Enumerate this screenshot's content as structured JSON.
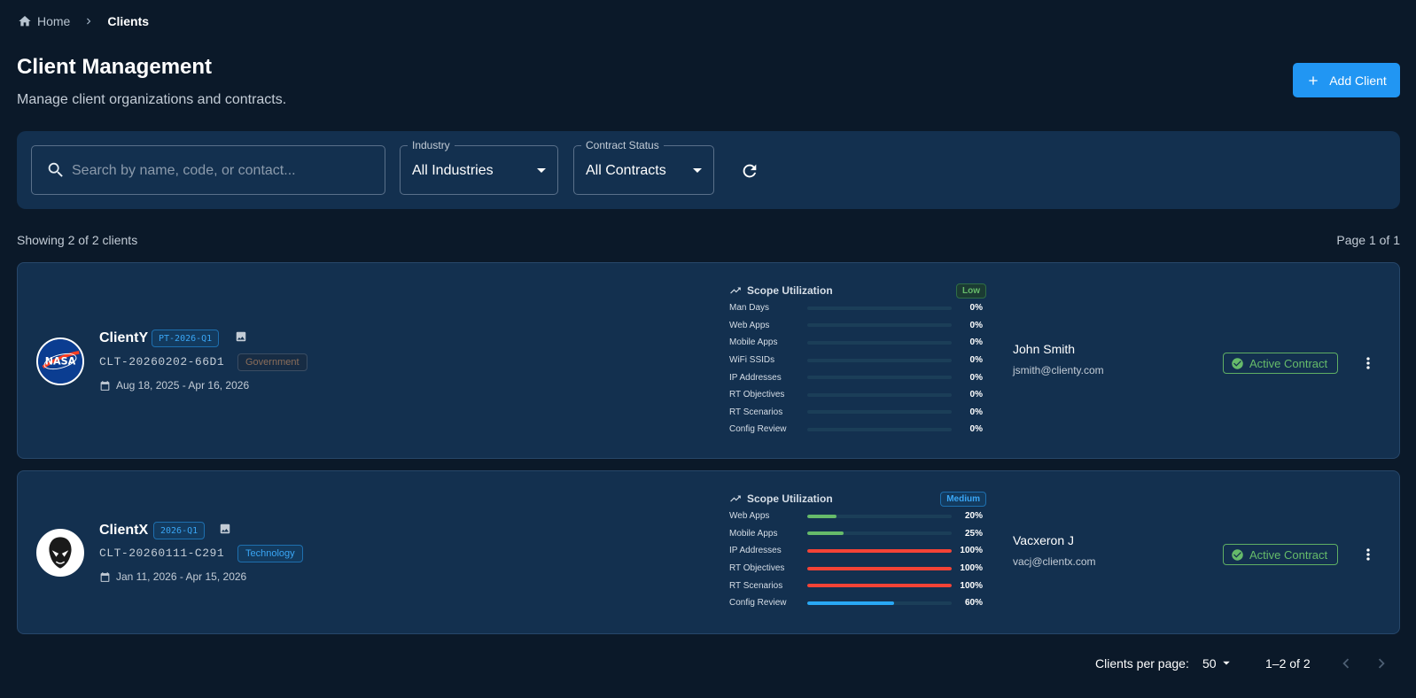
{
  "breadcrumb": {
    "home": "Home",
    "current": "Clients"
  },
  "header": {
    "title": "Client Management",
    "subtitle": "Manage client organizations and contracts.",
    "add_button": "Add Client"
  },
  "filters": {
    "search_placeholder": "Search by name, code, or contact...",
    "industry_label": "Industry",
    "industry_value": "All Industries",
    "status_label": "Contract Status",
    "status_value": "All Contracts"
  },
  "summary": {
    "showing": "Showing 2 of 2 clients",
    "page": "Page 1 of 1"
  },
  "clients": [
    {
      "name": "ClientY",
      "code": "PT-2026-Q1",
      "id": "CLT-20260202-66D1",
      "industry": "Government",
      "dates": "Aug 18, 2025 - Apr 16, 2026",
      "avatar_text": "NASA",
      "scope_title": "Scope Utilization",
      "scope_level": "Low",
      "metrics": [
        {
          "label": "Man Days",
          "pct": "0%",
          "value": 0,
          "color": "#66bb6a"
        },
        {
          "label": "Web Apps",
          "pct": "0%",
          "value": 0,
          "color": "#66bb6a"
        },
        {
          "label": "Mobile Apps",
          "pct": "0%",
          "value": 0,
          "color": "#66bb6a"
        },
        {
          "label": "WiFi SSIDs",
          "pct": "0%",
          "value": 0,
          "color": "#66bb6a"
        },
        {
          "label": "IP Addresses",
          "pct": "0%",
          "value": 0,
          "color": "#66bb6a"
        },
        {
          "label": "RT Objectives",
          "pct": "0%",
          "value": 0,
          "color": "#66bb6a"
        },
        {
          "label": "RT Scenarios",
          "pct": "0%",
          "value": 0,
          "color": "#66bb6a"
        },
        {
          "label": "Config Review",
          "pct": "0%",
          "value": 0,
          "color": "#66bb6a"
        }
      ],
      "contact_name": "John Smith",
      "contact_email": "jsmith@clienty.com",
      "status": "Active Contract"
    },
    {
      "name": "ClientX",
      "code": "2026-Q1",
      "id": "CLT-20260111-C291",
      "industry": "Technology",
      "dates": "Jan 11, 2026 - Apr 15, 2026",
      "avatar_text": "",
      "scope_title": "Scope Utilization",
      "scope_level": "Medium",
      "metrics": [
        {
          "label": "Web Apps",
          "pct": "20%",
          "value": 0.2,
          "color": "#66bb6a"
        },
        {
          "label": "Mobile Apps",
          "pct": "25%",
          "value": 0.25,
          "color": "#66bb6a"
        },
        {
          "label": "IP Addresses",
          "pct": "100%",
          "value": 1.0,
          "color": "#f44336"
        },
        {
          "label": "RT Objectives",
          "pct": "100%",
          "value": 1.0,
          "color": "#f44336"
        },
        {
          "label": "RT Scenarios",
          "pct": "100%",
          "value": 1.0,
          "color": "#f44336"
        },
        {
          "label": "Config Review",
          "pct": "60%",
          "value": 0.6,
          "color": "#29a8f5"
        }
      ],
      "contact_name": "Vacxeron J",
      "contact_email": "vacj@clientx.com",
      "status": "Active Contract"
    }
  ],
  "pagination": {
    "per_page_label": "Clients per page:",
    "per_page_value": "50",
    "range": "1–2 of 2"
  }
}
